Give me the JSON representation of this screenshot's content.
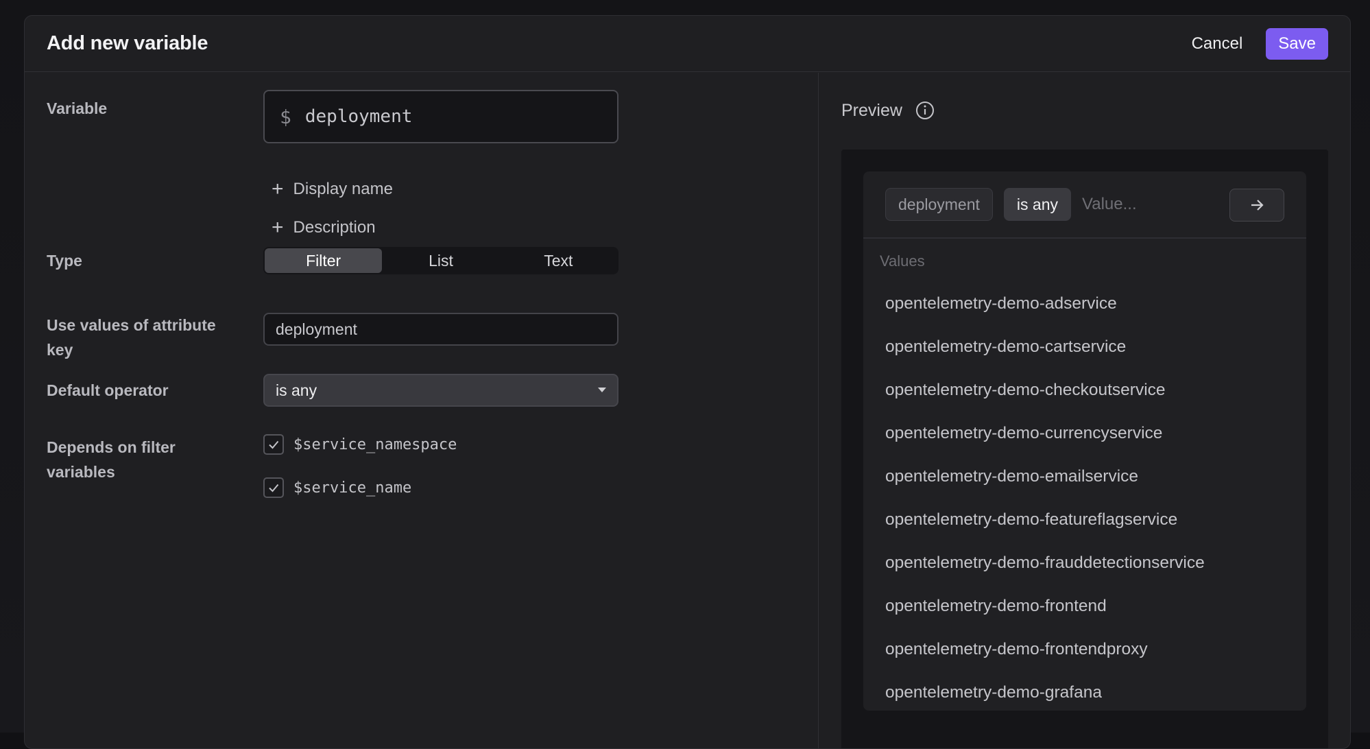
{
  "header": {
    "title": "Add new variable",
    "cancel_label": "Cancel",
    "save_label": "Save"
  },
  "form": {
    "variable_label": "Variable",
    "variable_prefix": "$",
    "variable_value": "deployment",
    "display_name_link": "Display name",
    "description_link": "Description",
    "type_label": "Type",
    "type_options": [
      "Filter",
      "List",
      "Text"
    ],
    "type_selected": "Filter",
    "attribute_key_label": "Use values of attribute key",
    "attribute_key_value": "deployment",
    "default_operator_label": "Default operator",
    "default_operator_value": "is any",
    "depends_label": "Depends on filter variables",
    "depends_items": [
      {
        "label": "$service_namespace",
        "checked": true
      },
      {
        "label": "$service_name",
        "checked": true
      }
    ]
  },
  "preview": {
    "title": "Preview",
    "chip_key": "deployment",
    "chip_operator": "is any",
    "value_placeholder": "Value...",
    "values_title": "Values",
    "values": [
      "opentelemetry-demo-adservice",
      "opentelemetry-demo-cartservice",
      "opentelemetry-demo-checkoutservice",
      "opentelemetry-demo-currencyservice",
      "opentelemetry-demo-emailservice",
      "opentelemetry-demo-featureflagservice",
      "opentelemetry-demo-frauddetectionservice",
      "opentelemetry-demo-frontend",
      "opentelemetry-demo-frontendproxy",
      "opentelemetry-demo-grafana"
    ]
  },
  "colors": {
    "accent": "#7c5cf0",
    "background": "#1f1f22"
  }
}
